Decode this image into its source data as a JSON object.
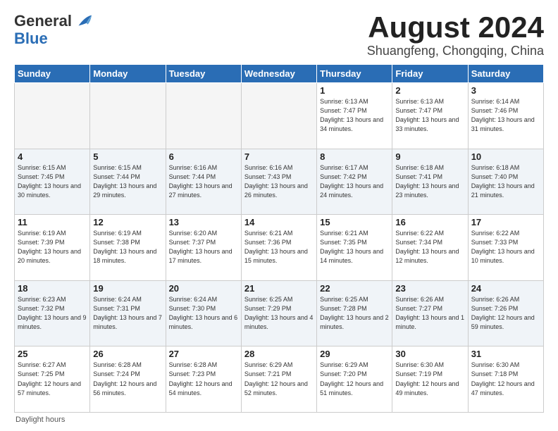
{
  "logo": {
    "general": "General",
    "blue": "Blue"
  },
  "header": {
    "month": "August 2024",
    "location": "Shuangfeng, Chongqing, China"
  },
  "weekdays": [
    "Sunday",
    "Monday",
    "Tuesday",
    "Wednesday",
    "Thursday",
    "Friday",
    "Saturday"
  ],
  "footer": {
    "daylight_label": "Daylight hours"
  },
  "weeks": [
    [
      {
        "day": "",
        "empty": true
      },
      {
        "day": "",
        "empty": true
      },
      {
        "day": "",
        "empty": true
      },
      {
        "day": "",
        "empty": true
      },
      {
        "day": "1",
        "sunrise": "6:13 AM",
        "sunset": "7:47 PM",
        "daylight": "13 hours and 34 minutes."
      },
      {
        "day": "2",
        "sunrise": "6:13 AM",
        "sunset": "7:47 PM",
        "daylight": "13 hours and 33 minutes."
      },
      {
        "day": "3",
        "sunrise": "6:14 AM",
        "sunset": "7:46 PM",
        "daylight": "13 hours and 31 minutes."
      }
    ],
    [
      {
        "day": "4",
        "sunrise": "6:15 AM",
        "sunset": "7:45 PM",
        "daylight": "13 hours and 30 minutes."
      },
      {
        "day": "5",
        "sunrise": "6:15 AM",
        "sunset": "7:44 PM",
        "daylight": "13 hours and 29 minutes."
      },
      {
        "day": "6",
        "sunrise": "6:16 AM",
        "sunset": "7:44 PM",
        "daylight": "13 hours and 27 minutes."
      },
      {
        "day": "7",
        "sunrise": "6:16 AM",
        "sunset": "7:43 PM",
        "daylight": "13 hours and 26 minutes."
      },
      {
        "day": "8",
        "sunrise": "6:17 AM",
        "sunset": "7:42 PM",
        "daylight": "13 hours and 24 minutes."
      },
      {
        "day": "9",
        "sunrise": "6:18 AM",
        "sunset": "7:41 PM",
        "daylight": "13 hours and 23 minutes."
      },
      {
        "day": "10",
        "sunrise": "6:18 AM",
        "sunset": "7:40 PM",
        "daylight": "13 hours and 21 minutes."
      }
    ],
    [
      {
        "day": "11",
        "sunrise": "6:19 AM",
        "sunset": "7:39 PM",
        "daylight": "13 hours and 20 minutes."
      },
      {
        "day": "12",
        "sunrise": "6:19 AM",
        "sunset": "7:38 PM",
        "daylight": "13 hours and 18 minutes."
      },
      {
        "day": "13",
        "sunrise": "6:20 AM",
        "sunset": "7:37 PM",
        "daylight": "13 hours and 17 minutes."
      },
      {
        "day": "14",
        "sunrise": "6:21 AM",
        "sunset": "7:36 PM",
        "daylight": "13 hours and 15 minutes."
      },
      {
        "day": "15",
        "sunrise": "6:21 AM",
        "sunset": "7:35 PM",
        "daylight": "13 hours and 14 minutes."
      },
      {
        "day": "16",
        "sunrise": "6:22 AM",
        "sunset": "7:34 PM",
        "daylight": "13 hours and 12 minutes."
      },
      {
        "day": "17",
        "sunrise": "6:22 AM",
        "sunset": "7:33 PM",
        "daylight": "13 hours and 10 minutes."
      }
    ],
    [
      {
        "day": "18",
        "sunrise": "6:23 AM",
        "sunset": "7:32 PM",
        "daylight": "13 hours and 9 minutes."
      },
      {
        "day": "19",
        "sunrise": "6:24 AM",
        "sunset": "7:31 PM",
        "daylight": "13 hours and 7 minutes."
      },
      {
        "day": "20",
        "sunrise": "6:24 AM",
        "sunset": "7:30 PM",
        "daylight": "13 hours and 6 minutes."
      },
      {
        "day": "21",
        "sunrise": "6:25 AM",
        "sunset": "7:29 PM",
        "daylight": "13 hours and 4 minutes."
      },
      {
        "day": "22",
        "sunrise": "6:25 AM",
        "sunset": "7:28 PM",
        "daylight": "13 hours and 2 minutes."
      },
      {
        "day": "23",
        "sunrise": "6:26 AM",
        "sunset": "7:27 PM",
        "daylight": "13 hours and 1 minute."
      },
      {
        "day": "24",
        "sunrise": "6:26 AM",
        "sunset": "7:26 PM",
        "daylight": "12 hours and 59 minutes."
      }
    ],
    [
      {
        "day": "25",
        "sunrise": "6:27 AM",
        "sunset": "7:25 PM",
        "daylight": "12 hours and 57 minutes."
      },
      {
        "day": "26",
        "sunrise": "6:28 AM",
        "sunset": "7:24 PM",
        "daylight": "12 hours and 56 minutes."
      },
      {
        "day": "27",
        "sunrise": "6:28 AM",
        "sunset": "7:23 PM",
        "daylight": "12 hours and 54 minutes."
      },
      {
        "day": "28",
        "sunrise": "6:29 AM",
        "sunset": "7:21 PM",
        "daylight": "12 hours and 52 minutes."
      },
      {
        "day": "29",
        "sunrise": "6:29 AM",
        "sunset": "7:20 PM",
        "daylight": "12 hours and 51 minutes."
      },
      {
        "day": "30",
        "sunrise": "6:30 AM",
        "sunset": "7:19 PM",
        "daylight": "12 hours and 49 minutes."
      },
      {
        "day": "31",
        "sunrise": "6:30 AM",
        "sunset": "7:18 PM",
        "daylight": "12 hours and 47 minutes."
      }
    ]
  ]
}
